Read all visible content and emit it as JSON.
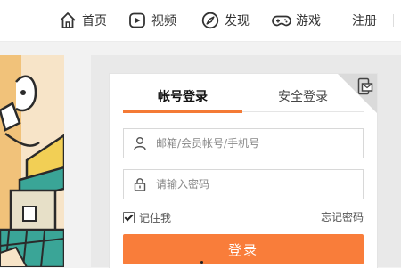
{
  "nav": {
    "home_label": "首页",
    "video_label": "视频",
    "discover_label": "发现",
    "game_label": "游戏",
    "register_label": "注册"
  },
  "login": {
    "tab_account": "帐号登录",
    "tab_secure": "安全登录",
    "username_placeholder": "邮箱/会员帐号/手机号",
    "password_placeholder": "请输入密码",
    "remember_label": "记住我",
    "remember_checked": true,
    "forgot_label": "忘记密码",
    "submit_label": "登录"
  },
  "colors": {
    "accent": "#f47a35",
    "button": "#f97d3a"
  },
  "icons": [
    "home-icon",
    "video-icon",
    "compass-icon",
    "gamepad-icon",
    "user-icon",
    "lock-icon",
    "qr-icon"
  ]
}
